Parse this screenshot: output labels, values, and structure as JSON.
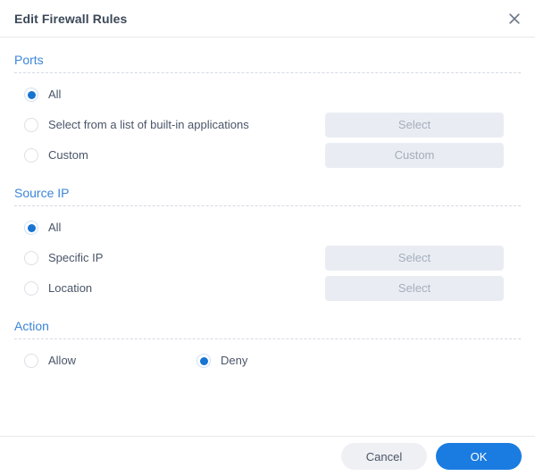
{
  "dialog": {
    "title": "Edit Firewall Rules",
    "close_icon": "close-icon"
  },
  "sections": [
    {
      "key": "ports",
      "title": "Ports",
      "options": [
        {
          "label": "All",
          "selected": true,
          "button": null
        },
        {
          "label": "Select from a list of built-in applications",
          "selected": false,
          "button": "Select"
        },
        {
          "label": "Custom",
          "selected": false,
          "button": "Custom"
        }
      ]
    },
    {
      "key": "source_ip",
      "title": "Source IP",
      "options": [
        {
          "label": "All",
          "selected": true,
          "button": null
        },
        {
          "label": "Specific IP",
          "selected": false,
          "button": "Select"
        },
        {
          "label": "Location",
          "selected": false,
          "button": "Select"
        }
      ]
    },
    {
      "key": "action",
      "title": "Action",
      "options": [
        {
          "label": "Allow",
          "selected": false,
          "button": null
        },
        {
          "label": "Deny",
          "selected": true,
          "button": null
        }
      ]
    }
  ],
  "ports": {
    "title": "Ports",
    "opt_all": "All",
    "opt_builtin": "Select from a list of built-in applications",
    "opt_custom": "Custom",
    "btn_select": "Select",
    "btn_custom": "Custom"
  },
  "source_ip": {
    "title": "Source IP",
    "opt_all": "All",
    "opt_specific": "Specific IP",
    "opt_location": "Location",
    "btn_specific_select": "Select",
    "btn_location_select": "Select"
  },
  "action": {
    "title": "Action",
    "opt_allow": "Allow",
    "opt_deny": "Deny"
  },
  "footer": {
    "cancel_label": "Cancel",
    "ok_label": "OK"
  },
  "colors": {
    "accent": "#1a7ce0",
    "section_title": "#3c86d8",
    "text": "#4a5568",
    "title_text": "#3c4858",
    "disabled_button_bg": "#e9edf3",
    "disabled_button_text": "#a5adbb",
    "cancel_bg": "#eef0f3",
    "divider": "#d4d9e1"
  }
}
